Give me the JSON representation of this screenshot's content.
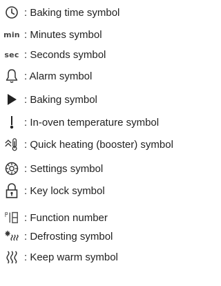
{
  "legend": {
    "items": [
      {
        "icon": "baking-time-icon",
        "icon_text": "",
        "label": ": Baking time symbol"
      },
      {
        "icon": "minutes-icon",
        "icon_text": "min",
        "label": ": Minutes symbol"
      },
      {
        "icon": "seconds-icon",
        "icon_text": "sec",
        "label": ": Seconds symbol"
      },
      {
        "icon": "alarm-icon",
        "icon_text": "",
        "label": ": Alarm symbol"
      },
      {
        "icon": "baking-icon",
        "icon_text": "",
        "label": ": Baking symbol"
      },
      {
        "icon": "in-oven-temperature-icon",
        "icon_text": "",
        "label": ": In-oven temperature symbol"
      },
      {
        "icon": "quick-heating-icon",
        "icon_text": "",
        "label": ": Quick heating (booster) symbol"
      },
      {
        "icon": "settings-icon",
        "icon_text": "",
        "label": ": Settings symbol"
      },
      {
        "icon": "key-lock-icon",
        "icon_text": "",
        "label": ": Key lock symbol"
      },
      {
        "icon": "function-number-icon",
        "icon_text": "",
        "label": ": Function number"
      },
      {
        "icon": "defrosting-icon",
        "icon_text": "",
        "label": ": Defrosting symbol"
      },
      {
        "icon": "keep-warm-icon",
        "icon_text": "",
        "label": ": Keep warm symbol"
      }
    ]
  }
}
